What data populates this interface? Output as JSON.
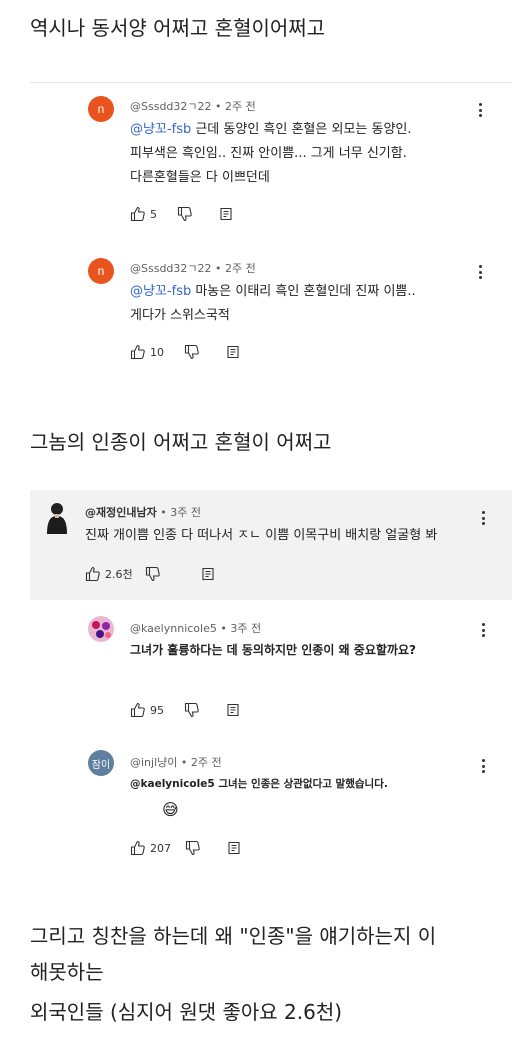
{
  "captions": {
    "top": "역시나 동서양 어쩌고 혼혈이어쩌고",
    "middle": "그놈의 인종이 어쩌고 혼혈이 어쩌고",
    "bottom_line1": "그리고 칭찬을 하는데 왜 \"인종\"을 얘기하는지 이",
    "bottom_line2": "해못하는",
    "bottom_line3": "외국인들 (심지어 원댓 좋아요 2.6천)"
  },
  "thread1": [
    {
      "avatar_letter": "n",
      "avatar_color": "#e9541e",
      "meta": "@Sssdd32ㄱ22 • 2주 전",
      "mention": "@냥꼬-fsb",
      "line1": " 근데 동양인 흑인 혼혈은 외모는 동양인.",
      "line2": "피부색은 흑인임.. 진짜 안이쁨... 그게 너무 신기함.",
      "line3": "다른혼혈들은 다 이쁘던데",
      "likes": "5"
    },
    {
      "avatar_letter": "n",
      "avatar_color": "#e9541e",
      "meta": "@Sssdd32ㄱ22 • 2주 전",
      "mention": "@냥꼬-fsb",
      "line1": " 마농은 이태리 흑인 혼혈인데 진짜 이쁨..",
      "line2": "게다가 스위스국적",
      "likes": "10"
    }
  ],
  "thread2": {
    "main": {
      "meta_name": "@재정인내남자",
      "meta_time": " • 3주 전",
      "line1": "진짜 개이쁨 인종 다 떠나서 ㅈㄴ 이쁨 이목구비 배치랑 얼굴형 봐",
      "likes": "2.6천"
    },
    "reply1": {
      "meta": "@kaelynnicole5 • 3주 전",
      "line1": "그녀가 훌륭하다는 데 동의하지만 인종이 왜 중요할까요?",
      "likes": "95"
    },
    "reply2": {
      "avatar_text": "잠이",
      "avatar_color": "#5f7f9f",
      "meta": "@injl냥이 • 2주 전",
      "line1": "@kaelynicole5 그녀는 인종은 상관없다고 말했습니다.",
      "emoji": "😅",
      "likes": "207"
    }
  },
  "icons": {
    "like": "thumbs-up-icon",
    "dislike": "thumbs-down-icon",
    "reply": "reply-icon",
    "more": "more-vert-icon"
  }
}
